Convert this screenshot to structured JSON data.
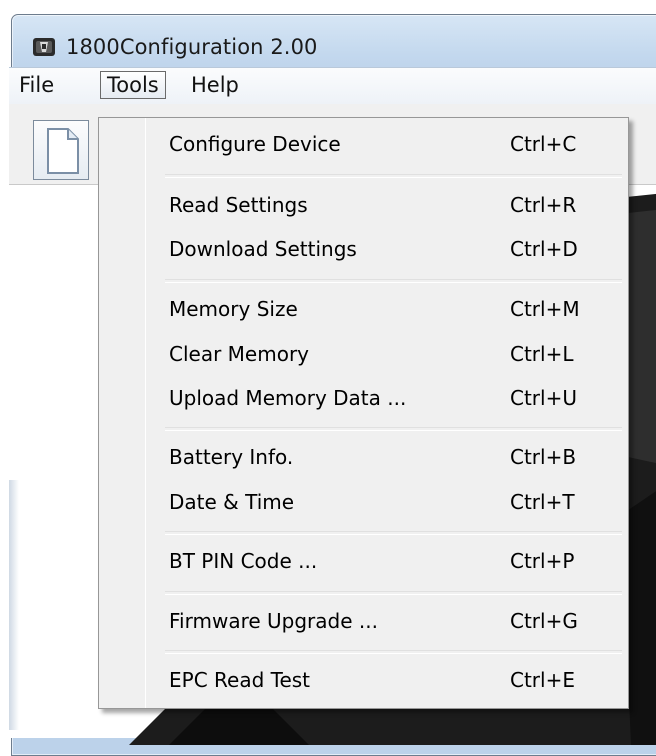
{
  "window": {
    "title": "1800Configuration 2.00",
    "app_icon": "app-icon"
  },
  "menubar": {
    "items": [
      {
        "label": "File",
        "active": false
      },
      {
        "label": "Tools",
        "active": true
      },
      {
        "label": "Help",
        "active": false
      }
    ]
  },
  "toolbar": {
    "new_icon": "new-document-icon"
  },
  "tools_menu": {
    "groups": [
      [
        {
          "label": "Configure Device",
          "shortcut": "Ctrl+C"
        }
      ],
      [
        {
          "label": "Read Settings",
          "shortcut": "Ctrl+R"
        },
        {
          "label": "Download Settings",
          "shortcut": "Ctrl+D"
        }
      ],
      [
        {
          "label": "Memory Size",
          "shortcut": "Ctrl+M"
        },
        {
          "label": "Clear Memory",
          "shortcut": "Ctrl+L"
        },
        {
          "label": "Upload Memory Data ...",
          "shortcut": "Ctrl+U"
        }
      ],
      [
        {
          "label": "Battery Info.",
          "shortcut": "Ctrl+B"
        },
        {
          "label": "Date & Time",
          "shortcut": "Ctrl+T"
        }
      ],
      [
        {
          "label": "BT PIN Code ...",
          "shortcut": "Ctrl+P"
        }
      ],
      [
        {
          "label": "Firmware Upgrade ...",
          "shortcut": "Ctrl+G"
        }
      ],
      [
        {
          "label": "EPC Read Test",
          "shortcut": "Ctrl+E"
        }
      ]
    ]
  },
  "colors": {
    "menu_bg": "#f0f0f0",
    "menu_border": "#979797",
    "titlebar": "#c3d8ee",
    "device_dark": "#1c1c1c"
  }
}
